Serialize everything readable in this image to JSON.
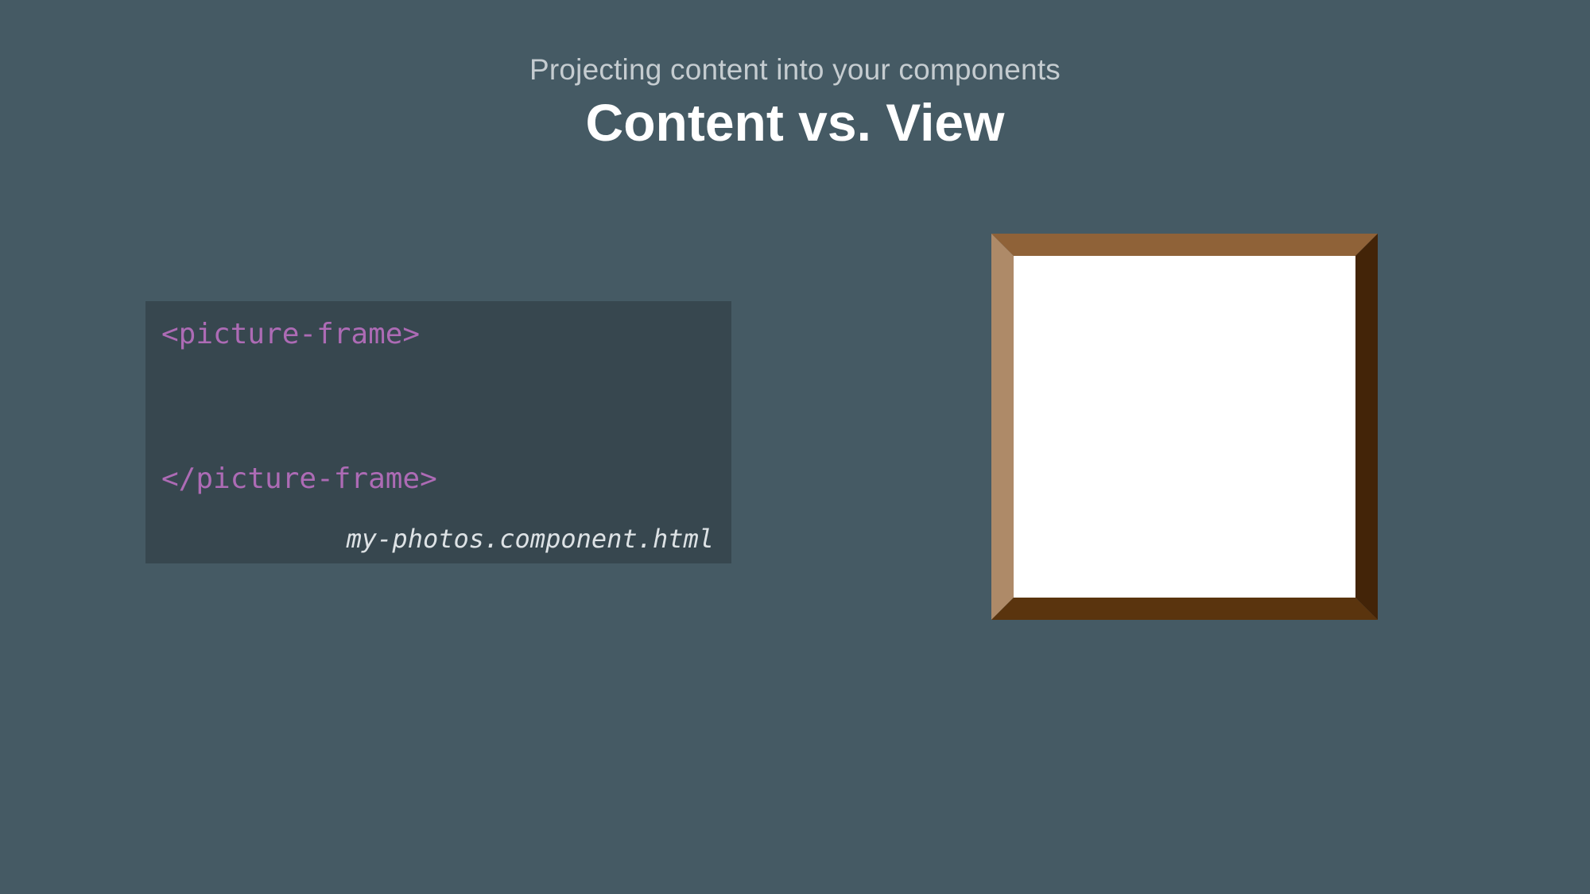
{
  "slide": {
    "subtitle": "Projecting content into your components",
    "title": "Content vs. View"
  },
  "code": {
    "open_tag": "<picture-frame>",
    "close_tag": "</picture-frame>",
    "filename": "my-photos.component.html"
  },
  "colors": {
    "background": "#455a64",
    "code_panel": "#37474f",
    "tag": "#ad6bb5",
    "frame_top": "#8f6238",
    "frame_left": "#ae8a68",
    "frame_right": "#432408",
    "frame_bottom": "#5a340e",
    "frame_inner": "#ffffff"
  },
  "illustration": {
    "icon": "picture-frame-icon"
  }
}
